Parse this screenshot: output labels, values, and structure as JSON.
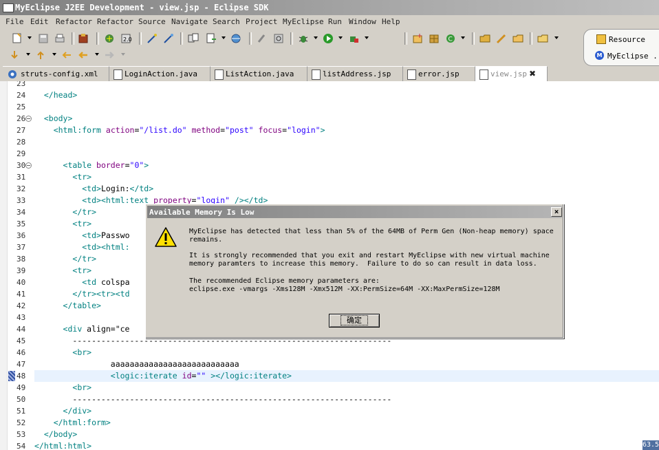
{
  "window": {
    "title": "MyEclipse J2EE Development - view.jsp - Eclipse SDK"
  },
  "menu": [
    "File",
    "Edit",
    "Refactor",
    "Refactor",
    "Source",
    "Navigate",
    "Search",
    "Project",
    "MyEclipse",
    "Run",
    "Window",
    "Help"
  ],
  "perspectives": {
    "resource": "Resource",
    "myeclipse": "MyEclipse ..."
  },
  "tabs": [
    {
      "label": "struts-config.xml",
      "icon": "gear-icon"
    },
    {
      "label": "LoginAction.java",
      "icon": "java-file-icon"
    },
    {
      "label": "ListAction.java",
      "icon": "java-file-icon"
    },
    {
      "label": "listAddress.jsp",
      "icon": "jsp-file-icon"
    },
    {
      "label": "error.jsp",
      "icon": "jsp-file-icon"
    },
    {
      "label": "view.jsp",
      "icon": "jsp-file-icon",
      "active": true
    }
  ],
  "editor": {
    "lines": [
      {
        "n": "23",
        "text": ""
      },
      {
        "n": "24",
        "text": "  </head>"
      },
      {
        "n": "25",
        "text": ""
      },
      {
        "n": "26",
        "text": "  <body>"
      },
      {
        "n": "27",
        "text": "    <html:form action=\"/list.do\" method=\"post\" focus=\"login\">"
      },
      {
        "n": "28",
        "text": ""
      },
      {
        "n": "29",
        "text": ""
      },
      {
        "n": "30",
        "text": "      <table border=\"0\">"
      },
      {
        "n": "31",
        "text": "        <tr>"
      },
      {
        "n": "32",
        "text": "          <td>Login:</td>"
      },
      {
        "n": "33",
        "text": "          <td><html:text property=\"login\" /></td>"
      },
      {
        "n": "34",
        "text": "        </tr>"
      },
      {
        "n": "35",
        "text": "        <tr>"
      },
      {
        "n": "36",
        "text": "          <td>Passwo"
      },
      {
        "n": "37",
        "text": "          <td><html:"
      },
      {
        "n": "38",
        "text": "        </tr>"
      },
      {
        "n": "39",
        "text": "        <tr>"
      },
      {
        "n": "40",
        "text": "          <td colspa"
      },
      {
        "n": "41",
        "text": "        </tr><tr><td"
      },
      {
        "n": "42",
        "text": "      </table>"
      },
      {
        "n": "43",
        "text": ""
      },
      {
        "n": "44",
        "text": "      <div align=\"ce"
      },
      {
        "n": "45",
        "text": "        -------------------------------------------------------------------"
      },
      {
        "n": "46",
        "text": "        <br>"
      },
      {
        "n": "47",
        "text": "                aaaaaaaaaaaaaaaaaaaaaaaaaaa"
      },
      {
        "n": "48",
        "text": "                <logic:iterate id=\"\" ></logic:iterate>"
      },
      {
        "n": "49",
        "text": "        <br>"
      },
      {
        "n": "50",
        "text": "        -------------------------------------------------------------------"
      },
      {
        "n": "51",
        "text": "      </div>"
      },
      {
        "n": "52",
        "text": "    </html:form>"
      },
      {
        "n": "53",
        "text": "  </body>"
      },
      {
        "n": "54",
        "text": "</html:html>"
      }
    ]
  },
  "status": {
    "memory": "63.5"
  },
  "dialog": {
    "title": "Available Memory Is Low",
    "close": "×",
    "p1": "MyEclipse has detected that less than 5% of the 64MB of Perm Gen (Non-heap memory) space\nremains.",
    "p2": "It is strongly recommended that you exit and restart MyEclipse with new virtual machine\nmemory paramters to increase this memory.  Failure to do so can result in data loss.",
    "p3": "The recommended Eclipse memory parameters are:\neclipse.exe -vmargs -Xms128M -Xmx512M -XX:PermSize=64M -XX:MaxPermSize=128M",
    "ok": "确定"
  }
}
